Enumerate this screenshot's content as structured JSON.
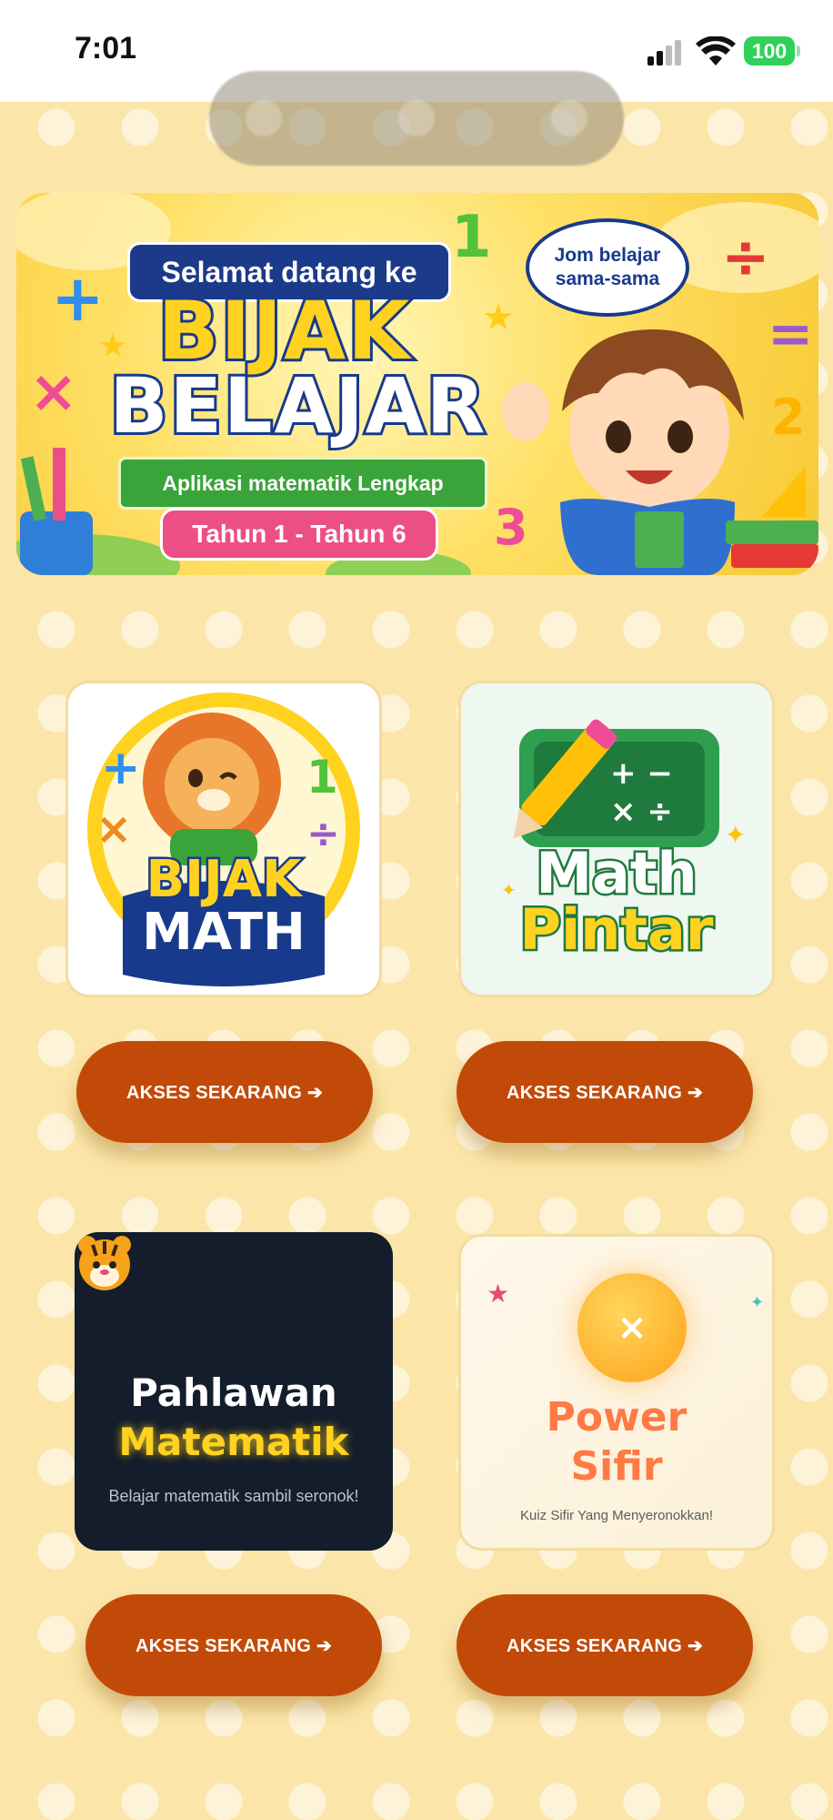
{
  "status_bar": {
    "time": "7:01",
    "battery": "100"
  },
  "banner": {
    "welcome": "Selamat datang ke",
    "title_line1": "BIJAK",
    "title_line2": "BELAJAR",
    "tagline": "Aplikasi matematik Lengkap",
    "years": "Tahun 1 - Tahun 6",
    "speech": "Jom belajar sama-sama"
  },
  "apps": [
    {
      "title_line1": "BIJAK",
      "title_line2": "MATH",
      "button": "AKSES SEKARANG ➔"
    },
    {
      "title_line1": "Math",
      "title_line2": "Pintar",
      "button": "AKSES SEKARANG ➔"
    },
    {
      "icon": "tiger-emoji-icon",
      "title_line1": "Pahlawan",
      "title_line2": "Matematik",
      "subtitle": "Belajar matematik sambil seronok!",
      "button": "AKSES SEKARANG ➔"
    },
    {
      "icon": "multiply-icon",
      "symbol": "×",
      "title_line1": "Power",
      "title_line2": "Sifir",
      "subtitle": "Kuiz Sifir Yang Menyeronokkan!",
      "button": "AKSES SEKARANG ➔"
    }
  ],
  "colors": {
    "background": "#fbe5a8",
    "button": "#c24a08",
    "navy": "#173a8c",
    "yellow": "#ffd21f",
    "dark_card": "#131d2b",
    "power_sifir_text": "#ff7a45"
  }
}
